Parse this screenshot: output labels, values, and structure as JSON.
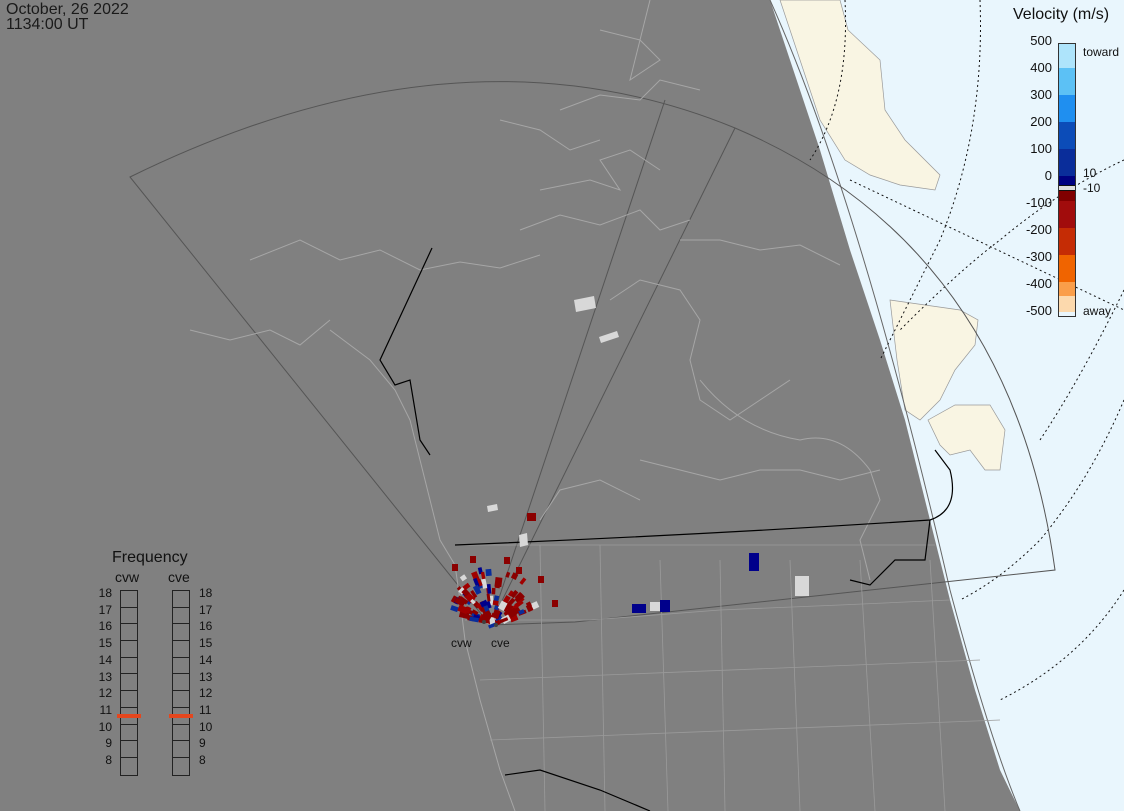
{
  "header": {
    "date": "October, 26 2022",
    "time": "1134:00 UT"
  },
  "velocity_legend": {
    "title": "Velocity (m/s)",
    "ticks": [
      "500",
      "400",
      "300",
      "200",
      "100",
      "0",
      "-100",
      "-200",
      "-300",
      "-400",
      "-500"
    ],
    "gap_upper": "10",
    "gap_lower": "-10",
    "toward_label": "toward",
    "away_label": "away"
  },
  "frequency_legend": {
    "title": "Frequency",
    "radars": [
      {
        "name": "cvw",
        "selected_mhz": 11
      },
      {
        "name": "cve",
        "selected_mhz": 11
      }
    ],
    "levels": [
      "18",
      "17",
      "16",
      "15",
      "14",
      "13",
      "12",
      "11",
      "10",
      "9",
      "8"
    ]
  },
  "sites": {
    "cvw": "cvw",
    "cve": "cve"
  },
  "colors": {
    "night": "#808080",
    "day_ocean": "#e8f6fd",
    "day_land": "#f9f5e3",
    "toward_dark": "#00008b",
    "away_dark": "#8b0000",
    "ground_scatter": "#d8d8d8",
    "freq_marker": "#e5461d"
  }
}
